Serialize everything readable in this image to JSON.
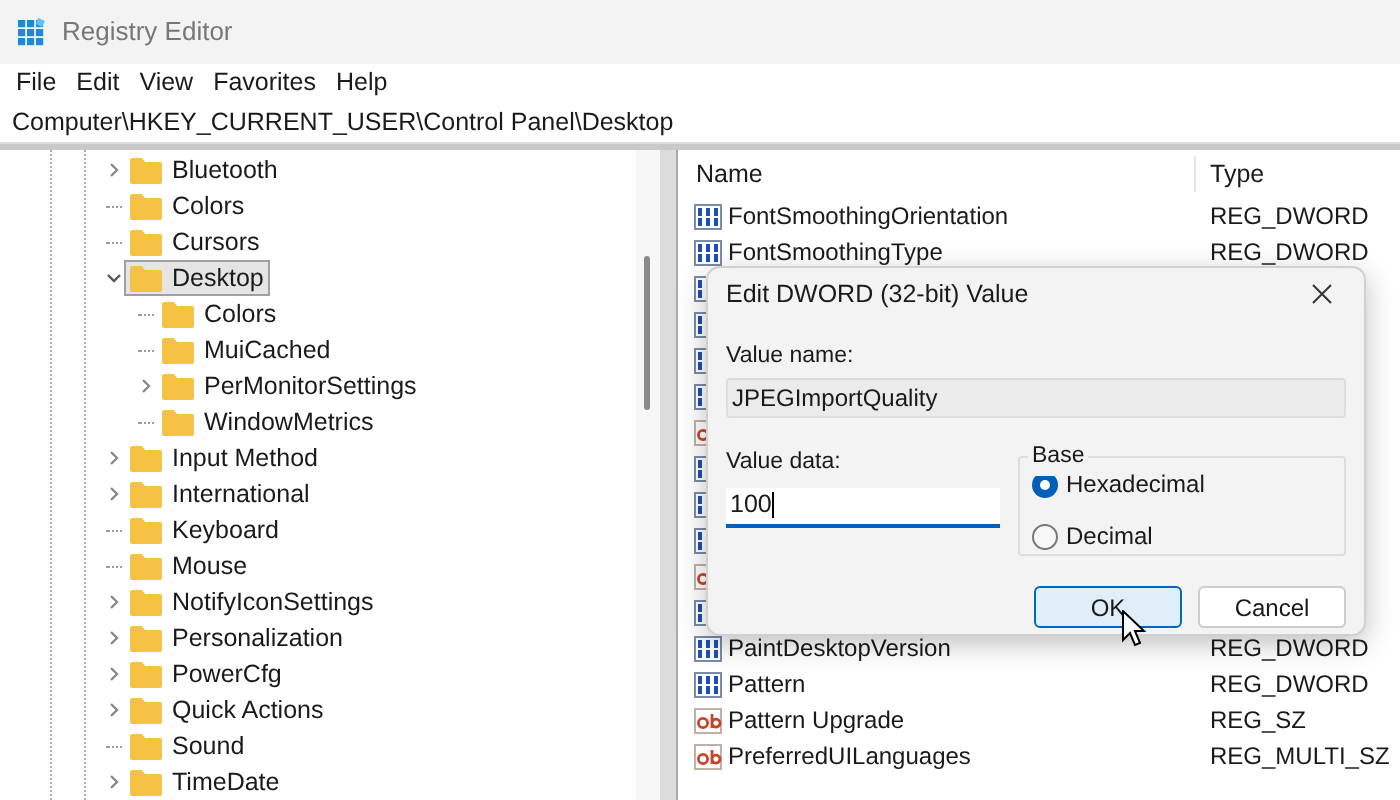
{
  "window": {
    "title": "Registry Editor"
  },
  "menu": [
    "File",
    "Edit",
    "View",
    "Favorites",
    "Help"
  ],
  "address": "Computer\\HKEY_CURRENT_USER\\Control Panel\\Desktop",
  "tree": [
    {
      "label": "Bluetooth",
      "expandable": true,
      "expanded": false,
      "selected": false
    },
    {
      "label": "Colors",
      "expandable": false,
      "expanded": false,
      "selected": false
    },
    {
      "label": "Cursors",
      "expandable": false,
      "expanded": false,
      "selected": false
    },
    {
      "label": "Desktop",
      "expandable": true,
      "expanded": true,
      "selected": true,
      "children": [
        {
          "label": "Colors",
          "expandable": false,
          "expanded": false,
          "selected": false
        },
        {
          "label": "MuiCached",
          "expandable": false,
          "expanded": false,
          "selected": false
        },
        {
          "label": "PerMonitorSettings",
          "expandable": true,
          "expanded": false,
          "selected": false
        },
        {
          "label": "WindowMetrics",
          "expandable": false,
          "expanded": false,
          "selected": false
        }
      ]
    },
    {
      "label": "Input Method",
      "expandable": true,
      "expanded": false,
      "selected": false
    },
    {
      "label": "International",
      "expandable": true,
      "expanded": false,
      "selected": false
    },
    {
      "label": "Keyboard",
      "expandable": false,
      "expanded": false,
      "selected": false
    },
    {
      "label": "Mouse",
      "expandable": false,
      "expanded": false,
      "selected": false
    },
    {
      "label": "NotifyIconSettings",
      "expandable": true,
      "expanded": false,
      "selected": false
    },
    {
      "label": "Personalization",
      "expandable": true,
      "expanded": false,
      "selected": false
    },
    {
      "label": "PowerCfg",
      "expandable": true,
      "expanded": false,
      "selected": false
    },
    {
      "label": "Quick Actions",
      "expandable": true,
      "expanded": false,
      "selected": false
    },
    {
      "label": "Sound",
      "expandable": false,
      "expanded": false,
      "selected": false
    },
    {
      "label": "TimeDate",
      "expandable": true,
      "expanded": false,
      "selected": false
    }
  ],
  "list": {
    "columns": [
      "Name",
      "Type"
    ],
    "rows": [
      {
        "kind": "dword",
        "name": "FontSmoothingOrientation",
        "type": "REG_DWORD"
      },
      {
        "kind": "dword",
        "name": "FontSmoothingType",
        "type": "REG_DWORD"
      },
      {
        "kind": "dword"
      },
      {
        "kind": "dword"
      },
      {
        "kind": "dword"
      },
      {
        "kind": "dword"
      },
      {
        "kind": "sz"
      },
      {
        "kind": "dword"
      },
      {
        "kind": "dword"
      },
      {
        "kind": "dword"
      },
      {
        "kind": "sz"
      },
      {
        "kind": "dword"
      },
      {
        "kind": "dword",
        "name": "PaintDesktopVersion",
        "type": "REG_DWORD"
      },
      {
        "kind": "dword",
        "name": "Pattern",
        "type": "REG_DWORD"
      },
      {
        "kind": "sz",
        "name": "Pattern Upgrade",
        "type": "REG_SZ"
      },
      {
        "kind": "sz",
        "name": "PreferredUILanguages",
        "type": "REG_MULTI_SZ"
      }
    ]
  },
  "dialog": {
    "title": "Edit DWORD (32-bit) Value",
    "value_name_label": "Value name:",
    "value_name": "JPEGImportQuality",
    "value_data_label": "Value data:",
    "value_data": "100",
    "base_label": "Base",
    "base_options": [
      {
        "label": "Hexadecimal",
        "selected": true
      },
      {
        "label": "Decimal",
        "selected": false
      }
    ],
    "buttons": [
      {
        "label": "OK",
        "default": true
      },
      {
        "label": "Cancel",
        "default": false
      }
    ]
  }
}
